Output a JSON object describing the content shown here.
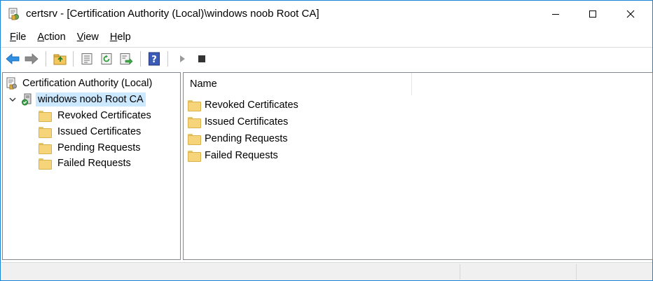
{
  "window": {
    "title": "certsrv - [Certification Authority (Local)\\windows noob Root CA]"
  },
  "menu": [
    {
      "key": "F",
      "rest": "ile"
    },
    {
      "key": "A",
      "rest": "ction"
    },
    {
      "key": "V",
      "rest": "iew"
    },
    {
      "key": "H",
      "rest": "elp"
    }
  ],
  "toolbar": {
    "icons": [
      "back-arrow-icon",
      "forward-arrow-icon",
      "up-folder-icon",
      "properties-icon",
      "refresh-icon",
      "export-list-icon",
      "help-icon",
      "start-service-icon",
      "stop-service-icon"
    ]
  },
  "tree": {
    "root": "Certification Authority (Local)",
    "ca": "windows noob Root CA",
    "children": [
      "Revoked Certificates",
      "Issued Certificates",
      "Pending Requests",
      "Failed Requests"
    ]
  },
  "list": {
    "column_name": "Name",
    "items": [
      "Revoked Certificates",
      "Issued Certificates",
      "Pending Requests",
      "Failed Requests"
    ]
  },
  "colors": {
    "selection": "#cce8ff",
    "border_accent": "#1883d7",
    "folder": "#f6d57a"
  }
}
